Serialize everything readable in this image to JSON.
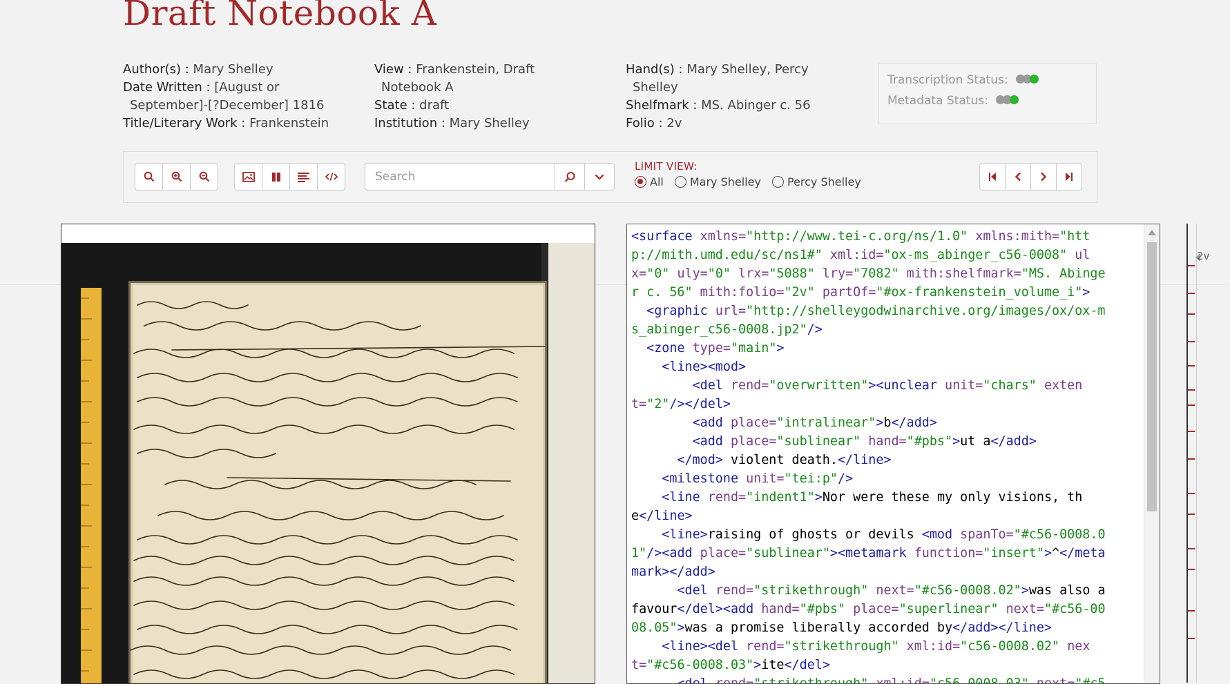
{
  "page": {
    "title": "Draft Notebook A"
  },
  "metadata": {
    "author_label": "Author(s) :",
    "author": "Mary Shelley",
    "date_label": "Date Written :",
    "date_line1": "[August or",
    "date_line2": "September]-[?December] 1816",
    "work_label": "Title/Literary Work :",
    "work": "Frankenstein",
    "view_label": "View :",
    "view_line1": "Frankenstein, Draft",
    "view_line2": "Notebook A",
    "state_label": "State :",
    "state": "draft",
    "institution_label": "Institution :",
    "institution": "Mary Shelley",
    "hands_label": "Hand(s) :",
    "hands_line1": "Mary Shelley, Percy",
    "hands_line2": "Shelley",
    "shelfmark_label": "Shelfmark :",
    "shelfmark": "MS. Abinger c. 56",
    "folio_label": "Folio :",
    "folio": "2v"
  },
  "status": {
    "transcription_label": "Transcription Status:",
    "metadata_label": "Metadata Status:",
    "colors": {
      "grey": "#9a9a9a",
      "green": "#2db52d"
    }
  },
  "toolbar": {
    "search_placeholder": "Search",
    "limit_label": "LIMIT VIEW:",
    "limit_options": [
      "All",
      "Mary Shelley",
      "Percy Shelley"
    ],
    "limit_selected": "All"
  },
  "icons": [
    "search-icon",
    "zoom-in-icon",
    "zoom-out-icon",
    "image-view-icon",
    "split-view-icon",
    "text-view-icon",
    "xml-view-icon",
    "search-submit-icon",
    "chevron-down-icon",
    "first-page-icon",
    "prev-page-icon",
    "next-page-icon",
    "last-page-icon"
  ],
  "folio_strip": {
    "current": "2v"
  },
  "accent": "#a3282a"
}
